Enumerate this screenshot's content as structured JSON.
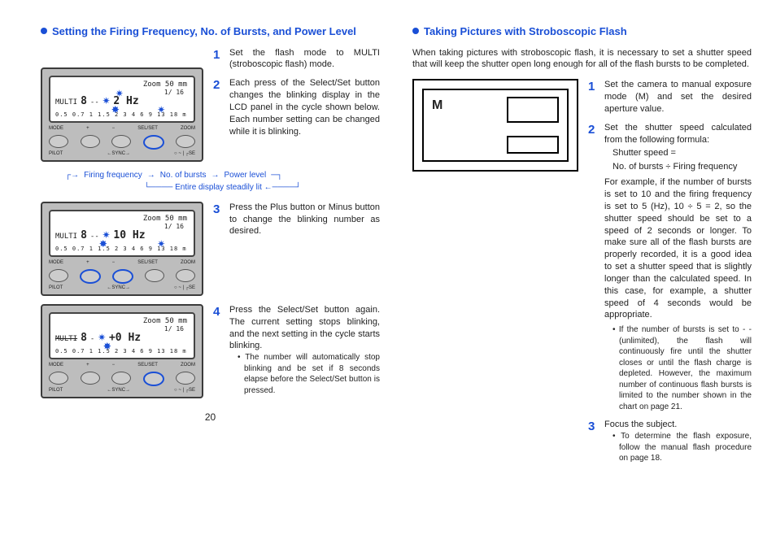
{
  "left": {
    "heading": "Setting the Firing Frequency, No. of Bursts, and Power Level",
    "step1": "Set the flash mode to MULTI (stroboscopic flash) mode.",
    "step2": "Each press of the Select/Set button changes the blinking display in the LCD panel in the cycle shown below. Each number setting can be changed while it is blinking.",
    "cycle_line1_a": "Firing frequency",
    "cycle_line1_b": "No. of bursts",
    "cycle_line1_c": "Power level",
    "cycle_line2": "Entire display steadily lit",
    "step3": "Press the Plus button or Minus button to change the blinking number as desired.",
    "step4": "Press the Select/Set button again. The current setting stops blinking, and the next setting in the cycle starts blinking.",
    "step4_note": "The number will automatically stop blinking and be set if 8 seconds elapse before the Select/Set button is pressed.",
    "lcd": {
      "zoom": "Zoom 50 mm",
      "aperture": "1/ 16",
      "mode": "MULTI",
      "burst_a": "8",
      "hz_a": "2 Hz",
      "hz_b": "10 Hz",
      "hz_c": "+0 Hz",
      "scale": "0.5 0.7 1 1.5 2  3 4  6 9 13 18 m"
    },
    "btn": {
      "mode": "MODE",
      "plus": "+",
      "minus": "−",
      "selset": "SEL/SET",
      "zoom": "ZOOM",
      "pilot": "PILOT",
      "sync": "←SYNC→",
      "rse": "○ ~ | ┌SE"
    }
  },
  "right": {
    "heading": "Taking Pictures with Stroboscopic Flash",
    "intro": "When taking pictures with stroboscopic flash, it is necessary to set a shutter speed that will keep the shutter open long enough for all of the flash bursts to be completed.",
    "cam_M": "M",
    "step1": "Set the camera to manual exposure mode (M) and set the desired aperture value.",
    "step2_a": "Set the shutter speed calculated from the following formula:",
    "step2_b": "Shutter speed =",
    "step2_c": "No. of bursts ÷ Firing frequency",
    "step2_d": "For example, if the number of bursts is set to 10 and the firing frequency is set to 5 (Hz), 10 ÷ 5 = 2, so the shutter speed should be set to a speed of 2 seconds or longer. To make sure all of the flash bursts are properly recorded, it is a good idea to set a shutter speed that is slightly longer than the calculated speed. In this case, for example, a shutter speed of 4 seconds would be appropriate.",
    "step2_note": "If the number of bursts is set to  - -  (unlimited), the flash will continuously fire until the shutter closes or until the flash charge is depleted. However, the maximum number of continuous flash bursts is limited to the number shown in the chart on page 21.",
    "step3": "Focus the subject.",
    "step3_note": "To determine the flash exposure, follow the manual flash procedure on page 18."
  },
  "pagenum": "20"
}
